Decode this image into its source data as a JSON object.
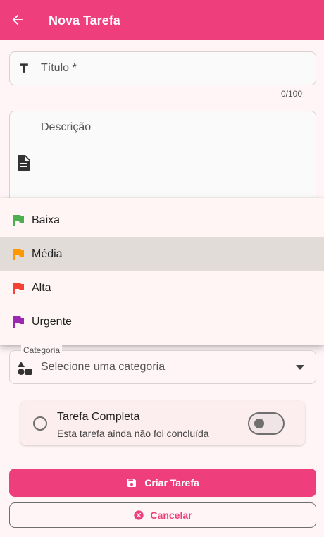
{
  "appbar": {
    "title": "Nova Tarefa"
  },
  "form": {
    "title_placeholder": "Título *",
    "title_counter": "0/100",
    "description_placeholder": "Descrição",
    "category_legend": "Categoria",
    "category_value": "Selecione uma categoria"
  },
  "priority_menu": {
    "items": [
      {
        "label": "Baixa",
        "color": "#4caf50",
        "icon": "flag-icon"
      },
      {
        "label": "Média",
        "color": "#ff9800",
        "icon": "flag-icon",
        "selected": true
      },
      {
        "label": "Alta",
        "color": "#f44336",
        "icon": "flag-icon"
      },
      {
        "label": "Urgente",
        "color": "#9c27b0",
        "icon": "flag-icon"
      }
    ]
  },
  "complete": {
    "title": "Tarefa Completa",
    "subtitle": "Esta tarefa ainda não foi concluída",
    "checked": false
  },
  "buttons": {
    "create_label": "Criar Tarefa",
    "cancel_label": "Cancelar"
  },
  "colors": {
    "primary": "#ee3f7c"
  }
}
